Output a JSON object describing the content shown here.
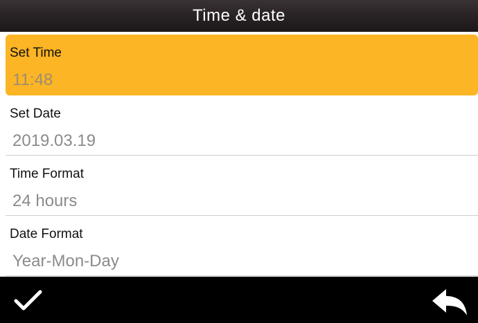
{
  "header": {
    "title": "Time & date"
  },
  "settings": {
    "items": [
      {
        "label": "Set Time",
        "value": "11:48",
        "selected": true
      },
      {
        "label": "Set Date",
        "value": "2019.03.19",
        "selected": false
      },
      {
        "label": "Time Format",
        "value": "24 hours",
        "selected": false
      },
      {
        "label": "Date Format",
        "value": "Year-Mon-Day",
        "selected": false
      }
    ]
  },
  "colors": {
    "highlight": "#fcb524",
    "title_bar": "#2a2426",
    "bottom_bar": "#000000",
    "value_text": "#8b8b8b"
  },
  "footer": {
    "confirm_icon": "checkmark-icon",
    "back_icon": "return-arrow-icon"
  }
}
